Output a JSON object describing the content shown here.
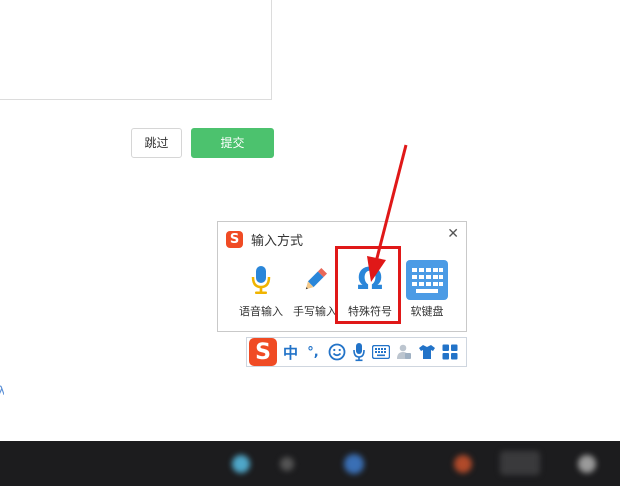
{
  "form": {
    "skip_label": "跳过",
    "submit_label": "提交",
    "colors": {
      "submit_bg": "#4cc26e"
    }
  },
  "left_link_text": "λ",
  "ime_popup": {
    "title": "输入方式",
    "close_icon": "close-icon",
    "options": [
      {
        "label": "语音输入",
        "icon": "microphone-icon"
      },
      {
        "label": "手写输入",
        "icon": "pen-icon"
      },
      {
        "label": "特殊符号",
        "icon": "omega-icon",
        "glyph": "Ω"
      },
      {
        "label": "软键盘",
        "icon": "keyboard-icon"
      }
    ],
    "logo_letter": "S"
  },
  "ime_bar": {
    "logo_letter": "S",
    "mode": "中",
    "punctuation": "°,",
    "icons": [
      "emoji-icon",
      "microphone-icon",
      "keyboard-icon",
      "user-icon",
      "skin-shirt-icon",
      "grid-menu-icon"
    ]
  },
  "annotation": {
    "highlight_color": "#e01818",
    "arrow_color": "#e01818"
  }
}
